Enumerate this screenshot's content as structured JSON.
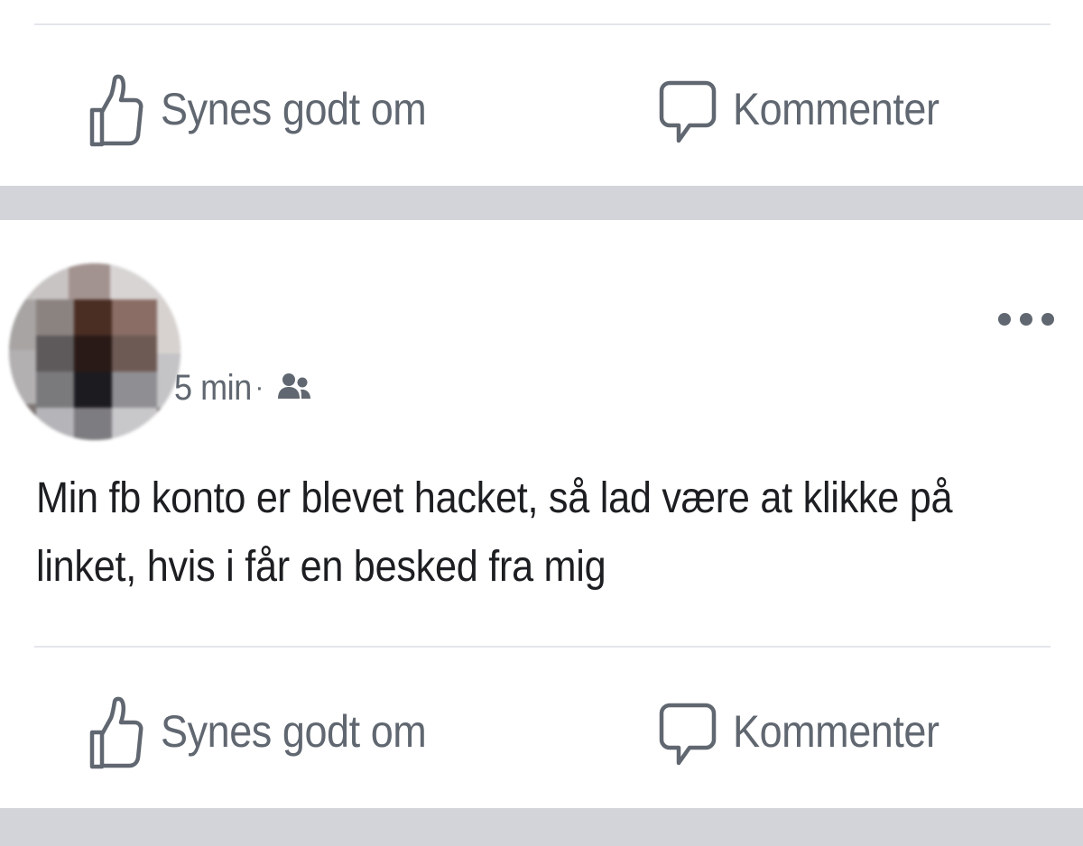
{
  "previous_post": {
    "actions": {
      "like_label": "Synes godt om",
      "comment_label": "Kommenter"
    }
  },
  "post": {
    "author": {
      "name": "",
      "avatar": "blurred-avatar"
    },
    "time": "5 min",
    "separator": "·",
    "audience_icon": "friends-icon",
    "more_icon": "more-options-icon",
    "text_lines": [
      "Min fb konto er blevet hacket, så lad være at klikke på",
      "linket, hvis i får en besked fra mig"
    ],
    "actions": {
      "like_label": "Synes godt om",
      "comment_label": "Kommenter"
    }
  },
  "colors": {
    "text_primary": "#1c1e21",
    "text_secondary": "#606770",
    "divider": "#e4e6eb",
    "feed_gap": "#d2d4d9"
  }
}
